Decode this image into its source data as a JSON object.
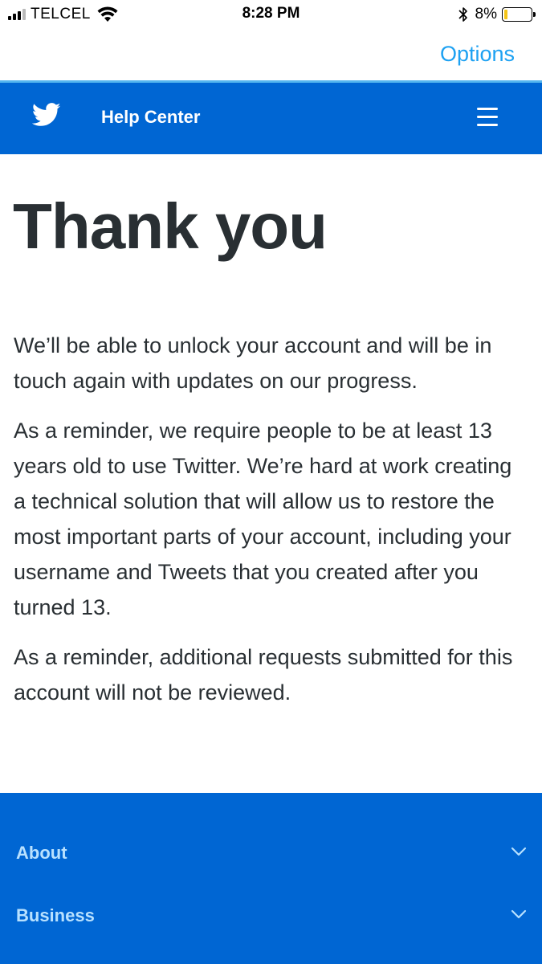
{
  "status_bar": {
    "carrier": "TELCEL",
    "time": "8:28 PM",
    "battery_percent": "8%",
    "battery_level": 0.08,
    "signal_bars": 3,
    "signal_bars_total": 4,
    "icons": [
      "wifi-icon",
      "bluetooth-icon",
      "battery-icon"
    ]
  },
  "options_bar": {
    "options_label": "Options"
  },
  "header": {
    "title": "Help Center",
    "logo": "twitter-bird-icon",
    "menu_icon": "hamburger-menu-icon"
  },
  "main": {
    "title": "Thank you",
    "paragraphs": [
      "We’ll be able to unlock your account and will be in touch again with updates on our progress.",
      "As a reminder, we require people to be at least 13 years old to use Twitter. We’re hard at work creating a technical solution that will allow us to restore the most important parts of your account, including your username and Tweets that you created after you turned 13.",
      "As a reminder, additional requests submitted for this account will not be reviewed."
    ]
  },
  "footer": {
    "items": [
      {
        "label": "About",
        "icon": "chevron-down-icon"
      },
      {
        "label": "Business",
        "icon": "chevron-down-icon"
      }
    ]
  },
  "colors": {
    "brand_blue": "#0066d3",
    "link_blue": "#1da1f2",
    "footer_link": "#b8e1ff",
    "text": "#292f33"
  }
}
